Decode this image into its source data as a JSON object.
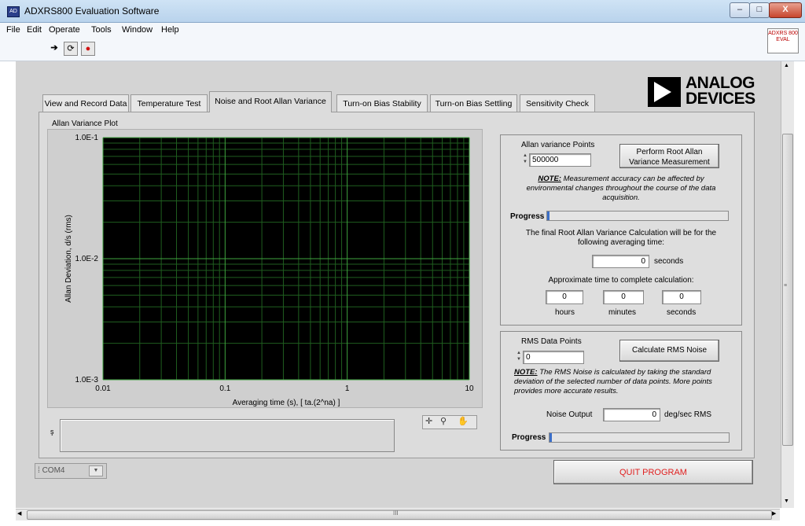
{
  "window": {
    "title": "ADXRS800 Evaluation Software",
    "icon_text": "AD",
    "minimize": "–",
    "maximize": "□",
    "close": "X"
  },
  "menu": [
    "File",
    "Edit",
    "Operate",
    "Tools",
    "Window",
    "Help"
  ],
  "toolbar": {
    "run_arrow": "➔",
    "run_continuous": "⟳",
    "abort": "●",
    "eval_icon_text": "ADXRS 800 EVAL"
  },
  "logo": {
    "line1": "ANALOG",
    "line2": "DEVICES"
  },
  "tabs": [
    "View and Record Data",
    "Temperature Test",
    "Noise and Root Allan Variance",
    "Turn-on Bias Stability",
    "Turn-on Bias Settling",
    "Sensitivity Check"
  ],
  "active_tab": "Noise and Root Allan Variance",
  "chart_data": {
    "type": "line",
    "title": "Allan Variance Plot",
    "xlabel": "Averaging time (s), [ ta.(2^na) ]",
    "ylabel": "Allan Deviation, d/s (rms)",
    "x_scale": "log",
    "y_scale": "log",
    "xlim": [
      0.01,
      10
    ],
    "ylim": [
      0.001,
      0.1
    ],
    "x_ticks": [
      {
        "v": 0.01,
        "label": "0.01"
      },
      {
        "v": 0.1,
        "label": "0.1"
      },
      {
        "v": 1,
        "label": "1"
      },
      {
        "v": 10,
        "label": "10"
      }
    ],
    "y_ticks": [
      {
        "v": 0.1,
        "label": "1.0E-1"
      },
      {
        "v": 0.01,
        "label": "1.0E-2"
      },
      {
        "v": 0.001,
        "label": "1.0E-3"
      }
    ],
    "grid": true,
    "series": [],
    "colors": {
      "background": "#000000",
      "major_grid": "#3fa33f",
      "minor_grid": "#1f5e1f"
    }
  },
  "chart_palette": {
    "cursor": "✛",
    "zoom": "⚲",
    "pan": "✋"
  },
  "message_box": {
    "label": "ş",
    "value": ""
  },
  "allan": {
    "points_label": "Allan variance Points",
    "points_value": "500000",
    "measure_button": "Perform Root Allan Variance Measurement",
    "note_prefix": "NOTE:",
    "note_text": "Measurement accuracy can be affected by environmental changes throughout the course of the data acquisition.",
    "progress_label": "Progress",
    "progress_value": 0.0,
    "final_calc_text": "The final Root Allan Variance Calculation will be for the following averaging time:",
    "averaging_time_value": "0",
    "averaging_time_unit": "seconds",
    "approx_label": "Approximate time to complete calculation:",
    "hours_value": "0",
    "hours_label": "hours",
    "minutes_value": "0",
    "minutes_label": "minutes",
    "seconds_value": "0",
    "seconds_label": "seconds"
  },
  "rms": {
    "points_label": "RMS Data Points",
    "points_value": "0",
    "calc_button": "Calculate RMS Noise",
    "note_prefix": "NOTE:",
    "note_text": "The RMS Noise is calculated by taking the standard deviation of the selected number of data points. More points provides more accurate results.",
    "output_label": "Noise Output",
    "output_value": "0",
    "output_unit": "deg/sec RMS",
    "progress_label": "Progress",
    "progress_value": 0.0
  },
  "com_port": {
    "value": "COM4",
    "arrow": "▼"
  },
  "quit_button": "QUIT PROGRAM",
  "scroll": {
    "up": "▲",
    "down": "▼",
    "left": "◀",
    "right": "▶",
    "grip": "III"
  }
}
